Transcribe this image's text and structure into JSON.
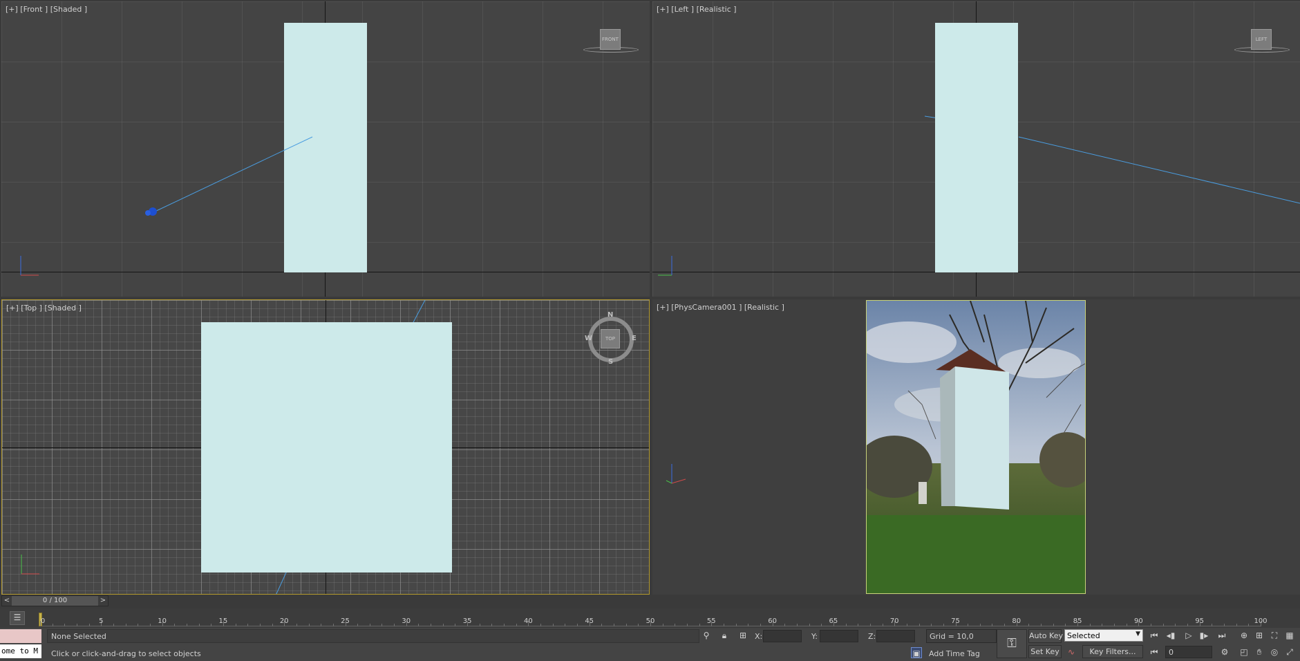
{
  "viewports": {
    "front": {
      "label": "[+] [Front ] [Shaded ]",
      "viewcube": "FRONT"
    },
    "left": {
      "label": "[+] [Left ] [Realistic ]",
      "viewcube": "LEFT"
    },
    "top": {
      "label": "[+] [Top ] [Shaded ]",
      "viewcube": "TOP",
      "compass": {
        "n": "N",
        "s": "S",
        "e": "E",
        "w": "W"
      }
    },
    "camera": {
      "label": "[+] [PhysCamera001 ] [Realistic ]"
    }
  },
  "time_slider": {
    "value": "0 / 100",
    "prev": "<",
    "next": ">"
  },
  "timeline": {
    "ticks": [
      "0",
      "5",
      "10",
      "15",
      "20",
      "25",
      "30",
      "35",
      "40",
      "45",
      "50",
      "55",
      "60",
      "65",
      "70",
      "75",
      "80",
      "85",
      "90",
      "95",
      "100"
    ]
  },
  "status_bar": {
    "maxscript_text": "ome to M",
    "selection": "None Selected",
    "prompt": "Click or click-and-drag to select objects",
    "x_label": "X:",
    "y_label": "Y:",
    "z_label": "Z:",
    "x_value": "",
    "y_value": "",
    "z_value": "",
    "grid": "Grid = 10,0",
    "add_time_tag": "Add Time Tag"
  },
  "animation": {
    "auto_key": "Auto Key",
    "set_key": "Set Key",
    "selected_option": "Selected",
    "key_filters": "Key Filters...",
    "frame": "0"
  },
  "icons": [
    "mini-curve-icon",
    "isolate-icon",
    "lock-icon",
    "absolute-mode-icon",
    "key-icon",
    "go-start-icon",
    "prev-frame-icon",
    "play-icon",
    "next-frame-icon",
    "go-end-icon",
    "zoom-icon",
    "zoom-all-icon",
    "zoom-extents-icon",
    "pan-icon",
    "orbit-icon",
    "maximize-icon"
  ],
  "colors": {
    "viewport": "#444444",
    "object": "#cdeaea",
    "active_border": "#b3992d",
    "link_line": "#4a9de0"
  }
}
